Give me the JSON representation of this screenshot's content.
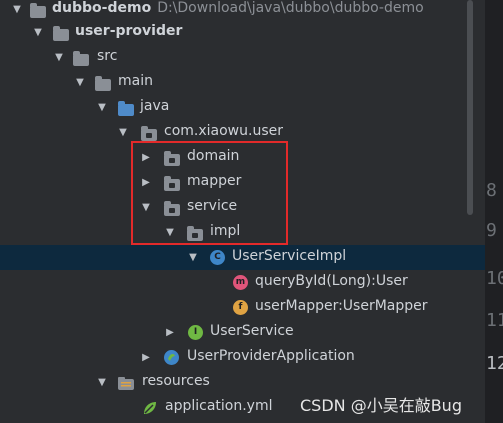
{
  "tree": {
    "project": {
      "name": "dubbo-demo",
      "path": "D:\\Download\\java\\dubbo\\dubbo-demo"
    },
    "module": {
      "name": "user-provider"
    },
    "src": {
      "label": "src"
    },
    "main": {
      "label": "main"
    },
    "java": {
      "label": "java"
    },
    "package": {
      "label": "com.xiaowu.user"
    },
    "domain": {
      "label": "domain"
    },
    "mapper": {
      "label": "mapper"
    },
    "service": {
      "label": "service"
    },
    "impl": {
      "label": "impl"
    },
    "impl_class": {
      "label": "UserServiceImpl",
      "icon": "class-icon",
      "icon_letter": "C"
    },
    "method": {
      "label": "queryById(Long):User",
      "icon": "method-icon",
      "icon_letter": "m"
    },
    "field": {
      "label": "userMapper:UserMapper",
      "icon": "field-icon",
      "icon_letter": "f"
    },
    "interface": {
      "label": "UserService",
      "icon": "interface-icon",
      "icon_letter": "I"
    },
    "app": {
      "label": "UserProviderApplication",
      "icon": "spring-boot-app-icon"
    },
    "resources": {
      "label": "resources"
    },
    "yml": {
      "label": "application.yml",
      "icon": "yaml-icon"
    }
  },
  "gutter_numbers": [
    "8",
    "9",
    "10",
    "11",
    "12"
  ],
  "watermark": "CSDN @小吴在敲Bug",
  "colors": {
    "background": "#2b2d30",
    "selection": "#0d293e",
    "highlight_box": "#e32a2a",
    "class_icon": "#3e86c8",
    "method_icon": "#e0557a",
    "field_icon": "#e0a343",
    "interface_icon": "#6fb843"
  }
}
